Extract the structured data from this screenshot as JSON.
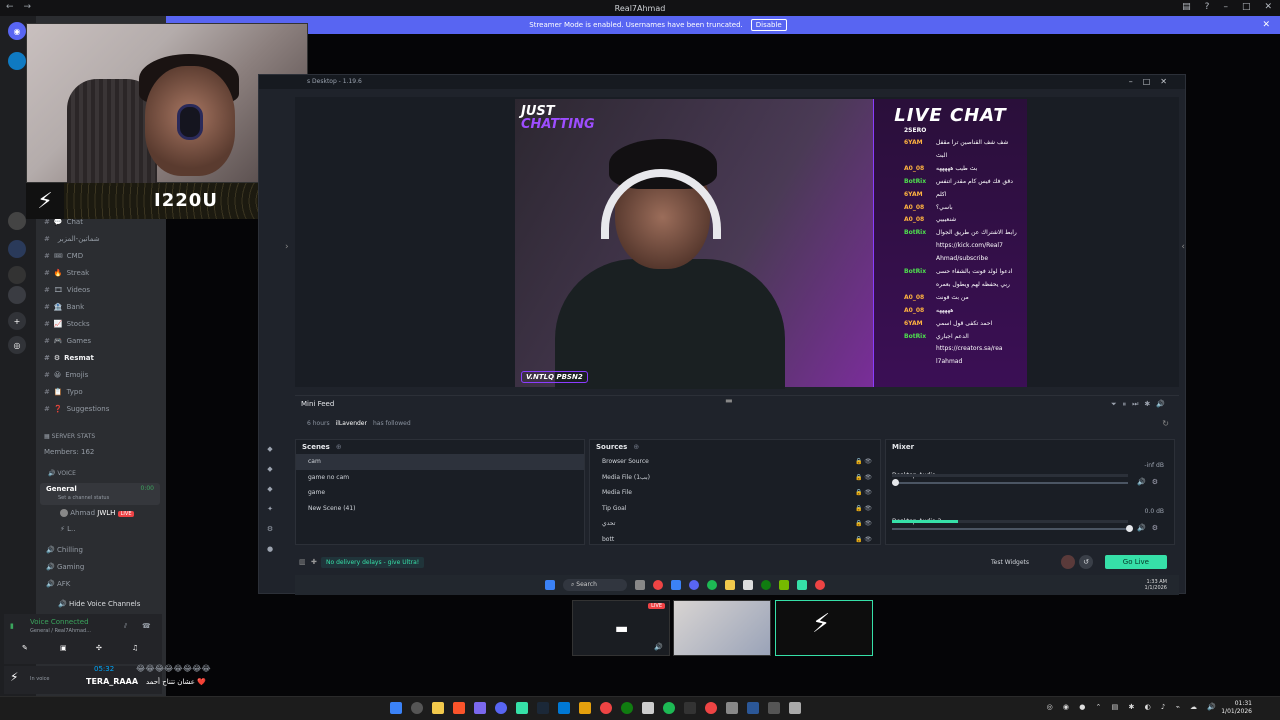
{
  "window": {
    "title": "Real7Ahmad"
  },
  "streamer_banner": {
    "text": "Streamer Mode is enabled. Usernames have been truncated.",
    "button": "Disable"
  },
  "webcam": {
    "name": "I220U"
  },
  "channels": [
    {
      "icon": "💬",
      "label": "Chat"
    },
    {
      "icon": "",
      "label": "شماتين-المزبر"
    },
    {
      "icon": "🎟",
      "label": "CMD"
    },
    {
      "icon": "🔥",
      "label": "Streak"
    },
    {
      "icon": "🎞",
      "label": "Videos"
    },
    {
      "icon": "🏦",
      "label": "Bank"
    },
    {
      "icon": "📈",
      "label": "Stocks"
    },
    {
      "icon": "🎮",
      "label": "Games"
    },
    {
      "icon": "⚙",
      "label": "Resmat"
    },
    {
      "icon": "😀",
      "label": "Emojis"
    },
    {
      "icon": "📋",
      "label": "Typo"
    },
    {
      "icon": "❓",
      "label": "Suggestions"
    }
  ],
  "server_stats": {
    "header": "SERVER STATS",
    "members": "Members: 162"
  },
  "voice": {
    "category": "VOICE",
    "general": "General",
    "general_status": "Set a channel status",
    "general_time": "0:00",
    "user1": "Ahmad",
    "user1_tag": "JWLH",
    "live": "LIVE",
    "user2": "L..",
    "chilling": "Chilling",
    "gaming": "Gaming",
    "afk": "AFK",
    "hide": "Hide Voice Channels",
    "connected": "Voice Connected",
    "connected_sub": "General / Real7Ahmad...",
    "in_voice": "In voice",
    "chat_time": "05:32",
    "chat_emojis": "😂😂😂😂😂😂😂😂",
    "chat_user": "TERA_RAAA",
    "chat_text": "عشان تتناح أحمد ❤️"
  },
  "obs": {
    "title": "s Desktop - 1.19.6",
    "overlay": {
      "just": "JUST",
      "chatting": "CHATTING",
      "socials": "V.NTLQ  PBSN2"
    },
    "live_chat": {
      "title": "LIVE CHAT",
      "first_user": "2SERO",
      "messages": [
        {
          "user": "6YAM",
          "text": "شف شف القناصين ترا مقفل",
          "color": ""
        },
        {
          "user": "",
          "text": "البث",
          "color": "w"
        },
        {
          "user": "A0_08",
          "text": "بث طيب هههههه",
          "color": ""
        },
        {
          "user": "BotRix",
          "text": "دقق فك فيس كام مقدر اتنفس",
          "color": "g"
        },
        {
          "user": "6YAM",
          "text": "اكلم",
          "color": ""
        },
        {
          "user": "A0_08",
          "text": "باسي؟",
          "color": ""
        },
        {
          "user": "A0_08",
          "text": "شنعيبيي",
          "color": ""
        },
        {
          "user": "BotRix",
          "text": "رابط الاشتراك عن طريق الجوال",
          "color": "g"
        },
        {
          "user": "",
          "text": "https://kick.com/Real7",
          "color": "w"
        },
        {
          "user": "",
          "text": "Ahmad/subscribe",
          "color": "w"
        },
        {
          "user": "BotRix",
          "text": "ادعوا لولد فونت بالشفاء حسى",
          "color": "g"
        },
        {
          "user": "",
          "text": "ربي يحفظه لهم ويطول بعمره",
          "color": "w"
        },
        {
          "user": "A0_08",
          "text": "من بث فونت",
          "color": ""
        },
        {
          "user": "A0_08",
          "text": "هههههه",
          "color": ""
        },
        {
          "user": "6YAM",
          "text": "احمد تكفى قول اسمي",
          "color": ""
        },
        {
          "user": "BotRix",
          "text": "الدعم اجباري",
          "color": "g"
        },
        {
          "user": "",
          "text": "https://creators.sa/rea",
          "color": "w"
        },
        {
          "user": "",
          "text": "l7ahmad",
          "color": "w"
        }
      ]
    },
    "mini_feed": {
      "title": "Mini Feed",
      "time": "6 hours",
      "user": "ilLavender",
      "action": "has followed"
    },
    "scenes": {
      "title": "Scenes",
      "items": [
        "cam",
        "game no cam",
        "game",
        "New Scene (41)"
      ]
    },
    "sources": {
      "title": "Sources",
      "items": [
        "Browser Source",
        "Media File (بب1)",
        "Media File",
        "Tip Goal",
        "تحدي",
        "bott"
      ]
    },
    "mixer": {
      "title": "Mixer",
      "channels": [
        {
          "name": "Desktop Audio",
          "db": "-inf dB",
          "level": 0.0
        },
        {
          "name": "Desktop Audio 2",
          "db": "0.0 dB",
          "level": 0.28
        }
      ]
    },
    "ultra": "No delivery delays - give Ultra!",
    "test_widgets": "Test Widgets",
    "go_live": "Go Live",
    "taskbar": {
      "search": "Search",
      "time": "1:33 AM",
      "date": "1/1/2026"
    }
  },
  "taskbar": {
    "time": "01:31",
    "date": "1/01/2026"
  },
  "colors": {
    "blurple": "#5865f2",
    "obs_accent": "#36e0a8",
    "purple": "#8a3cff"
  }
}
